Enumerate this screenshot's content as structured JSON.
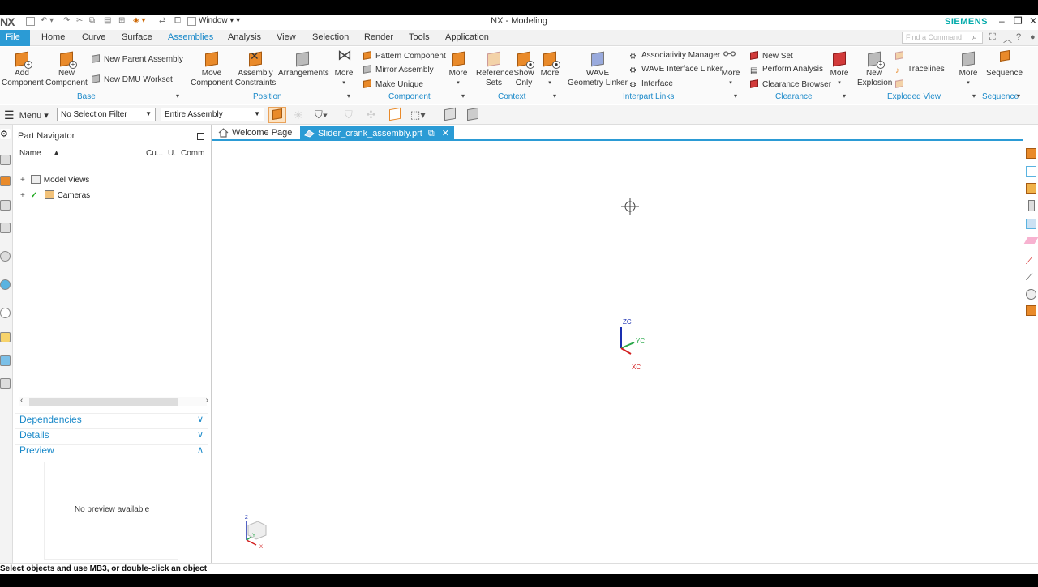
{
  "window": {
    "title": "NX - Modeling",
    "brand": "SIEMENS",
    "logo": "NX",
    "window_menu_label": "Window"
  },
  "tabs": [
    {
      "label": "File"
    },
    {
      "label": "Home"
    },
    {
      "label": "Curve"
    },
    {
      "label": "Surface"
    },
    {
      "label": "Assemblies"
    },
    {
      "label": "Analysis"
    },
    {
      "label": "View"
    },
    {
      "label": "Selection"
    },
    {
      "label": "Render"
    },
    {
      "label": "Tools"
    },
    {
      "label": "Application"
    }
  ],
  "active_tab": "Assemblies",
  "find_command": {
    "placeholder": "Find a Command"
  },
  "ribbon": {
    "base": {
      "group": "Base",
      "add_component": "Add Component",
      "new_component": "New Component",
      "new_parent_assembly": "New Parent Assembly",
      "new_dmu_workset": "New DMU Workset"
    },
    "position": {
      "group": "Position",
      "move_component": "Move Component",
      "assembly_constraints": "Assembly Constraints",
      "arrangements": "Arrangements",
      "more": "More"
    },
    "component": {
      "group": "Component",
      "pattern_component": "Pattern Component",
      "mirror_assembly": "Mirror Assembly",
      "make_unique": "Make Unique",
      "more": "More"
    },
    "context": {
      "group": "Context",
      "reference_sets": "Reference Sets",
      "show_only": "Show Only",
      "more": "More"
    },
    "interpart": {
      "group": "Interpart Links",
      "wave_geometry_linker": "WAVE Geometry Linker",
      "associativity_manager": "Associativity Manager",
      "wave_interface_linker": "WAVE Interface Linker",
      "interface": "Interface",
      "more": "More"
    },
    "clearance": {
      "group": "Clearance",
      "new_set": "New Set",
      "perform_analysis": "Perform Analysis",
      "clearance_browser": "Clearance Browser",
      "more": "More"
    },
    "exploded": {
      "group": "Exploded View",
      "new_explosion": "New Explosion",
      "tracelines": "Tracelines",
      "more": "More"
    },
    "sequence": {
      "group": "Sequence",
      "sequence": "Sequence"
    }
  },
  "selection_bar": {
    "menu": "Menu",
    "filter": "No Selection Filter",
    "scope": "Entire Assembly"
  },
  "navigator": {
    "title": "Part Navigator",
    "columns": {
      "name": "Name",
      "current": "Cu...",
      "up": "U.",
      "comment": "Comm"
    },
    "rows": [
      {
        "label": "Model Views",
        "expander": "+"
      },
      {
        "label": "Cameras",
        "expander": "+"
      }
    ],
    "sections": {
      "dependencies": "Dependencies",
      "details": "Details",
      "preview": "Preview"
    },
    "preview_empty": "No preview available"
  },
  "documents": {
    "welcome": "Welcome Page",
    "active": "Slider_crank_assembly.prt"
  },
  "triad": {
    "zc": "ZC",
    "yc": "YC",
    "xc": "XC"
  },
  "view_triad": {
    "z": "Z",
    "y": "Y",
    "x": "X"
  },
  "status": {
    "text": "Select objects and use MB3, or double-click an object"
  },
  "colors": {
    "accent": "#2b9bd5",
    "brand": "#00a0a0",
    "orange": "#e98a2a"
  }
}
